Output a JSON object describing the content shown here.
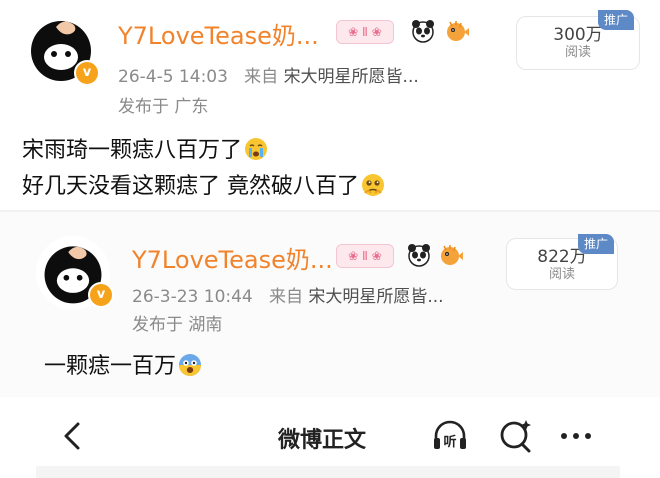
{
  "posts": [
    {
      "username": "Y7LoveTease奶...",
      "timestamp": "26-4-5 14:03",
      "source_prefix": "来自",
      "source": "宋大明星所愿皆...",
      "location": "发布于 广东",
      "views": "300万",
      "views_label": "阅读",
      "promo_label": "推广",
      "content_lines": [
        "宋雨琦一颗痣八百万了",
        "好几天没看这颗痣了 竟然破八百了"
      ],
      "line_emojis": [
        "crying-face",
        "pleading-face"
      ],
      "verified_mark": "v"
    },
    {
      "username": "Y7LoveTease奶...",
      "timestamp": "26-3-23 10:44",
      "source_prefix": "来自",
      "source": "宋大明星所愿皆...",
      "location": "发布于 湖南",
      "views": "822万",
      "views_label": "阅读",
      "promo_label": "推广",
      "content_lines": [
        "一颗痣一百万"
      ],
      "line_emojis": [
        "shocked-face"
      ],
      "verified_mark": "v"
    }
  ],
  "navbar": {
    "title": "微博正文",
    "listen_label": "听"
  },
  "icons": [
    "back-chevron-icon",
    "listen-icon",
    "search-sparkle-icon",
    "more-dots-icon",
    "panda-icon",
    "pufferfish-icon"
  ],
  "colors": {
    "username": "#f0832c",
    "promo": "#5e89c7",
    "verified": "#f7a21b"
  }
}
